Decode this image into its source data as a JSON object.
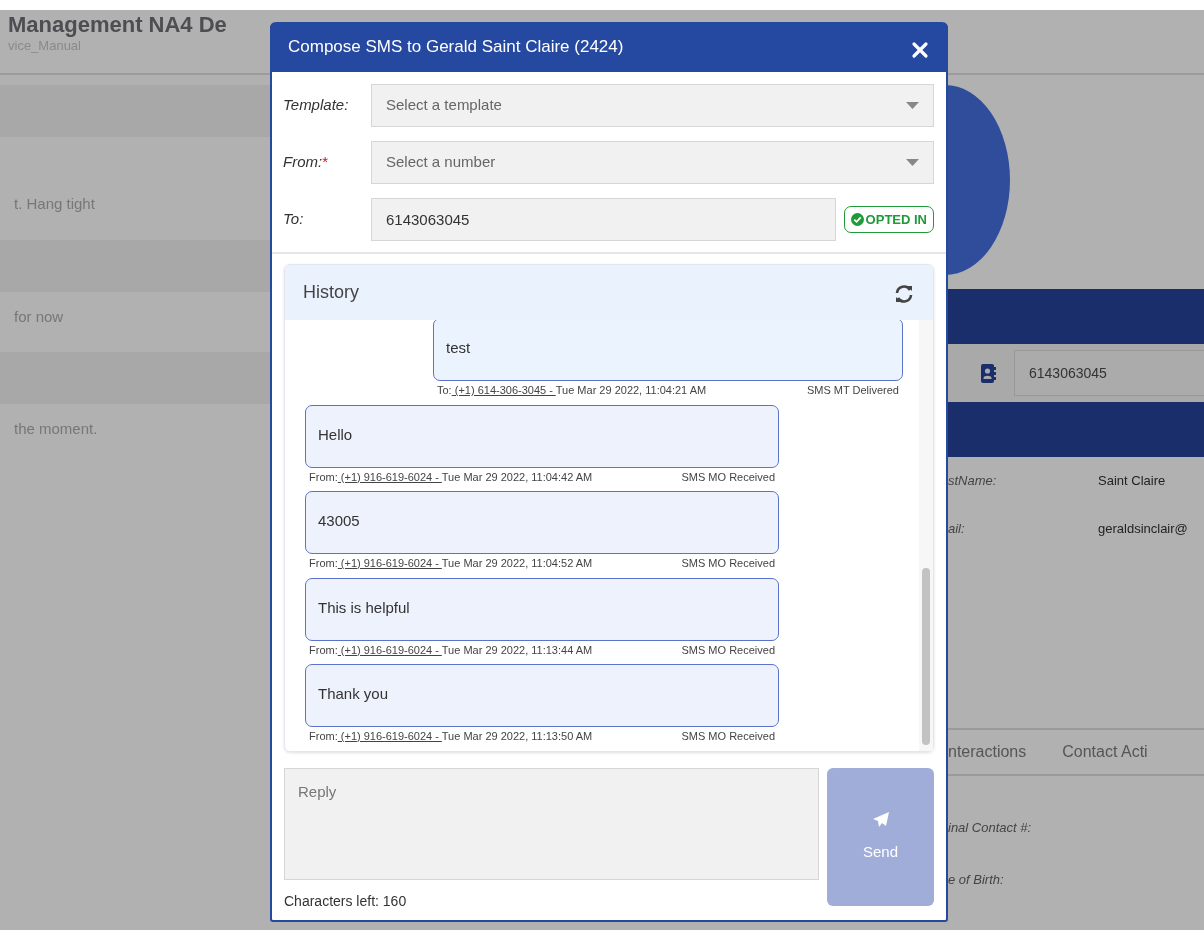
{
  "background": {
    "title": "Management NA4 De",
    "subtitle": "vice_Manual",
    "left_texts": [
      "t. Hang tight",
      "for now",
      "the moment."
    ],
    "phone_value": "6143063045",
    "fields": [
      {
        "label": "stName:",
        "value": "Saint Claire"
      },
      {
        "label": "ail:",
        "value": "geraldsinclair@"
      }
    ],
    "tabs": [
      {
        "label": "nteractions"
      },
      {
        "label": "Contact Acti"
      }
    ],
    "labels": [
      "inal Contact #:",
      "e of Birth:"
    ]
  },
  "dialog": {
    "title": "Compose SMS to Gerald Saint Claire (2424)",
    "fields": [
      {
        "kind": "select",
        "label": "Template:",
        "placeholder": "Select a template"
      },
      {
        "kind": "select",
        "label": "From:",
        "required_mark": "*",
        "placeholder": "Select a number"
      },
      {
        "kind": "input",
        "label": "To:",
        "value": "6143063045",
        "badge": "OPTED IN"
      }
    ],
    "history": {
      "title": "History",
      "messages": [
        {
          "kind": "outgoing",
          "text": "test",
          "prefix": "To:",
          "number": " (+1) 614-306-3045 - ",
          "time": "Tue Mar 29 2022, 11:04:21 AM",
          "status": "SMS MT Delivered"
        },
        {
          "kind": "incoming",
          "text": "Hello",
          "prefix": "From:",
          "number": " (+1) 916-619-6024 - ",
          "time": "Tue Mar 29 2022, 11:04:42 AM",
          "status": "SMS MO Received"
        },
        {
          "kind": "incoming",
          "text": "43005",
          "prefix": "From:",
          "number": " (+1) 916-619-6024 - ",
          "time": "Tue Mar 29 2022, 11:04:52 AM",
          "status": "SMS MO Received"
        },
        {
          "kind": "incoming",
          "text": "This is helpful",
          "prefix": "From:",
          "number": " (+1) 916-619-6024 - ",
          "time": "Tue Mar 29 2022, 11:13:44 AM",
          "status": "SMS MO Received"
        },
        {
          "kind": "incoming",
          "text": "Thank you",
          "prefix": "From:",
          "number": " (+1) 916-619-6024 - ",
          "time": "Tue Mar 29 2022, 11:13:50 AM",
          "status": "SMS MO Received"
        }
      ]
    },
    "reply": {
      "placeholder": "Reply"
    },
    "chars_left": "Characters left: 160",
    "send": {
      "label": "Send",
      "disabled": true
    }
  }
}
